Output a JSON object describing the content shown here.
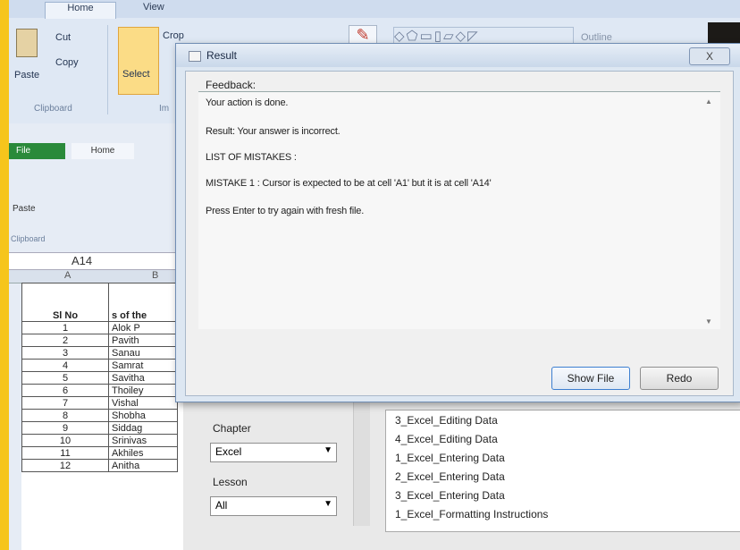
{
  "paint": {
    "tabs": [
      "Home",
      "View"
    ],
    "cut": "Cut",
    "copy": "Copy",
    "paste": "Paste",
    "select": "Select",
    "crop": "Crop",
    "clipboard_group": "Clipboard",
    "image_group": "Im",
    "outline": "Outline"
  },
  "excel": {
    "file_tab": "File",
    "home_tab": "Home",
    "name_box": "A14",
    "col_a": "A",
    "col_b": "B",
    "clipboard_group": "Clipboard",
    "paste": "Paste",
    "header_no": "Sl No",
    "header_name": "s of the",
    "rows": [
      {
        "no": "1",
        "name": "Alok P"
      },
      {
        "no": "2",
        "name": "Pavith"
      },
      {
        "no": "3",
        "name": "Sanau"
      },
      {
        "no": "4",
        "name": "Samrat"
      },
      {
        "no": "5",
        "name": "Savitha"
      },
      {
        "no": "6",
        "name": "Thoiley"
      },
      {
        "no": "7",
        "name": "Vishal"
      },
      {
        "no": "8",
        "name": "Shobha"
      },
      {
        "no": "9",
        "name": "Siddag"
      },
      {
        "no": "10",
        "name": "Srinivas"
      },
      {
        "no": "11",
        "name": "Akhiles"
      },
      {
        "no": "12",
        "name": "Anitha"
      }
    ]
  },
  "dialog": {
    "title": "Result",
    "close": "X",
    "feedback_label": "Feedback:",
    "lines": [
      "Your action is done.",
      "Result: Your answer is incorrect.",
      "LIST OF MISTAKES :",
      "MISTAKE 1 :  Cursor is expected to be at cell 'A1' but it is at cell 'A14'",
      "Press Enter to try again with fresh file."
    ],
    "show_file": "Show File",
    "redo": "Redo"
  },
  "panel": {
    "chapter_label": "Chapter",
    "chapter_value": "Excel",
    "lesson_label": "Lesson",
    "lesson_value": "All",
    "lessons": [
      "3_Excel_Editing Data",
      "4_Excel_Editing Data",
      "1_Excel_Entering Data",
      "2_Excel_Entering Data",
      "3_Excel_Entering Data",
      "1_Excel_Formatting Instructions"
    ]
  }
}
